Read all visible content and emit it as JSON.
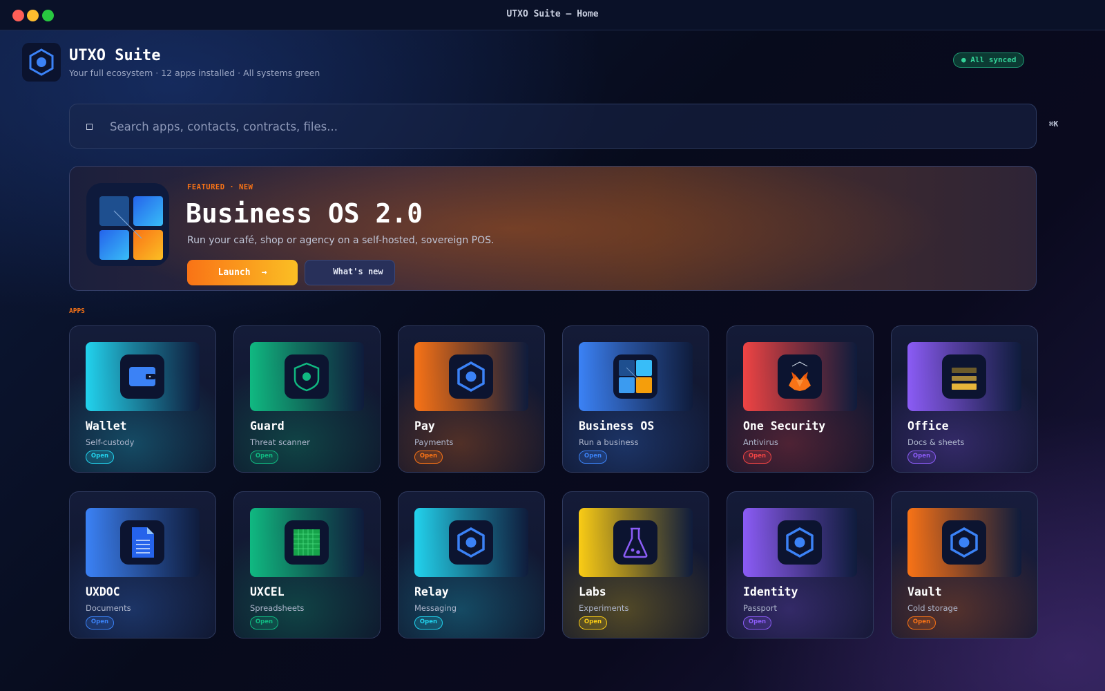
{
  "window": {
    "title": "UTXO Suite — Home"
  },
  "header": {
    "app_name": "UTXO Suite",
    "tagline": "Your full ecosystem · 12 apps installed · All systems green",
    "sync_badge": "● All synced"
  },
  "search": {
    "placeholder": "Search apps, contacts, contracts, files...",
    "value": "",
    "shortcut": "⌘K"
  },
  "featured": {
    "label": "FEATURED · NEW",
    "title": "Business OS 2.0",
    "description": "Run your café, shop or agency on a self-hosted, sovereign POS.",
    "launch_label": "Launch",
    "launch_arrow": "→",
    "whats_new_label": "What's new"
  },
  "apps_section_label": "APPS",
  "apps": [
    {
      "name": "Wallet",
      "subtitle": "Self-custody",
      "action": "Open",
      "icon": "wallet-icon",
      "color": "#22d3ee"
    },
    {
      "name": "Guard",
      "subtitle": "Threat scanner",
      "action": "Open",
      "icon": "shield-icon",
      "color": "#10b981"
    },
    {
      "name": "Pay",
      "subtitle": "Payments",
      "action": "Open",
      "icon": "hexagon-icon",
      "color": "#f97316"
    },
    {
      "name": "Business OS",
      "subtitle": "Run a business",
      "action": "Open",
      "icon": "grid-icon",
      "color": "#3b82f6"
    },
    {
      "name": "One Security",
      "subtitle": "Antivirus",
      "action": "Open",
      "icon": "fox-icon",
      "color": "#ef4444"
    },
    {
      "name": "Office",
      "subtitle": "Docs & sheets",
      "action": "Open",
      "icon": "stack-icon",
      "color": "#8b5cf6"
    },
    {
      "name": "UXDOC",
      "subtitle": "Documents",
      "action": "Open",
      "icon": "document-icon",
      "color": "#3b82f6"
    },
    {
      "name": "UXCEL",
      "subtitle": "Spreadsheets",
      "action": "Open",
      "icon": "spreadsheet-icon",
      "color": "#10b981"
    },
    {
      "name": "Relay",
      "subtitle": "Messaging",
      "action": "Open",
      "icon": "hexagon-icon",
      "color": "#22d3ee"
    },
    {
      "name": "Labs",
      "subtitle": "Experiments",
      "action": "Open",
      "icon": "flask-icon",
      "color": "#facc15"
    },
    {
      "name": "Identity",
      "subtitle": "Passport",
      "action": "Open",
      "icon": "hexagon-icon",
      "color": "#8b5cf6"
    },
    {
      "name": "Vault",
      "subtitle": "Cold storage",
      "action": "Open",
      "icon": "hexagon-icon",
      "color": "#f97316"
    }
  ]
}
